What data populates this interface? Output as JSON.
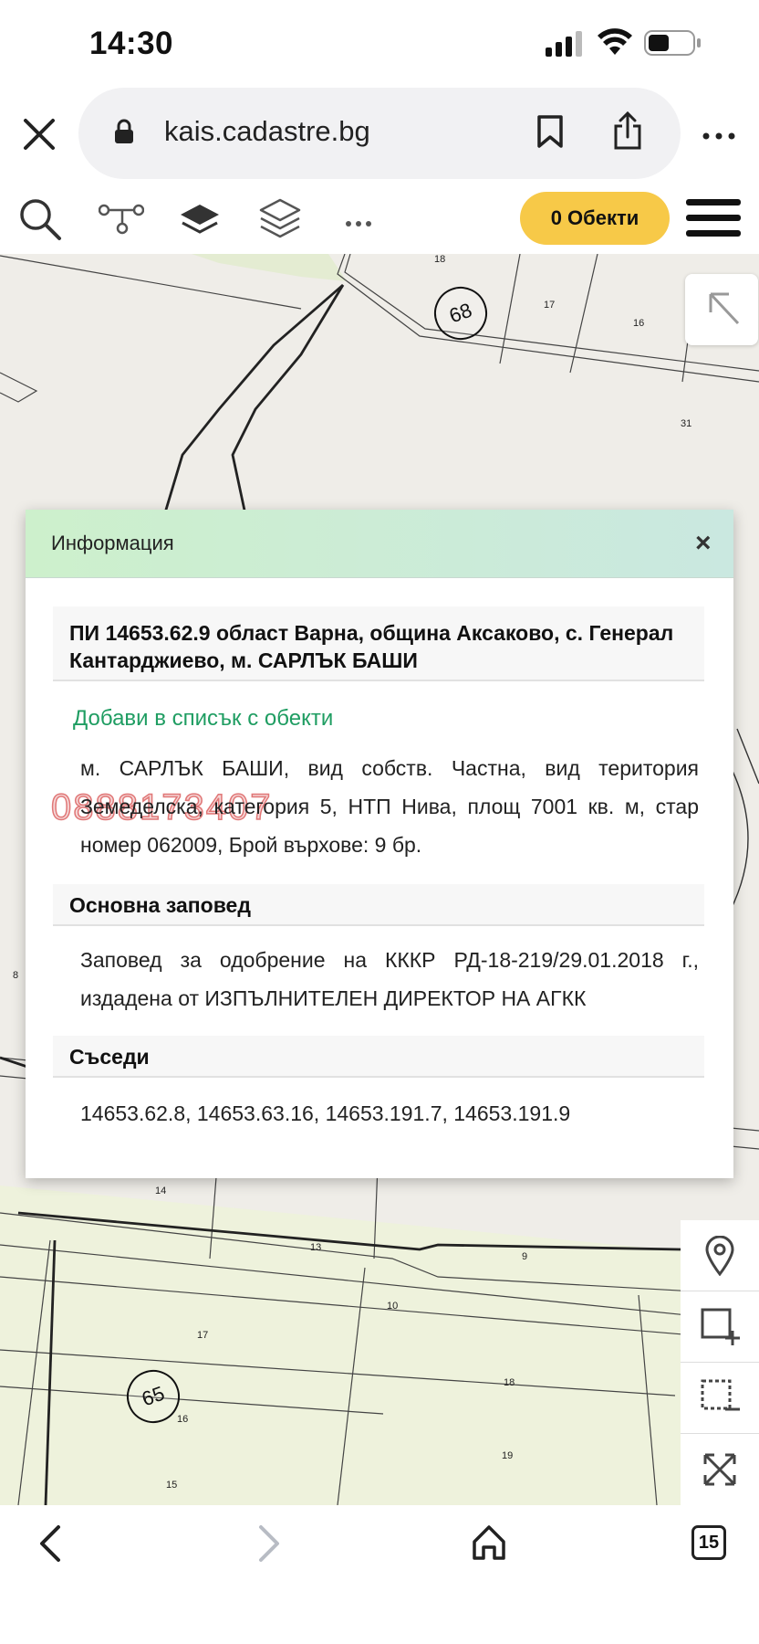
{
  "status_bar": {
    "time": "14:30"
  },
  "browser": {
    "url": "kais.cadastre.bg"
  },
  "toolbar": {
    "objects_button": "0 Обекти"
  },
  "map": {
    "parcel_labels": [
      "68",
      "65"
    ],
    "plot_numbers": [
      "18",
      "17",
      "16",
      "31",
      "14",
      "13",
      "9",
      "17",
      "16",
      "15",
      "18",
      "19",
      "10",
      "8"
    ]
  },
  "info_panel": {
    "title": "Информация",
    "close": "×",
    "heading": "ПИ 14653.62.9 област Варна, община Аксаково, с. Генерал Кантарджиево, м. САРЛЪК БАШИ",
    "add_link": "Добави в списък с обекти",
    "description": "м. САРЛЪК БАШИ, вид собств. Частна, вид територия Земеделска, категория 5, НТП Нива, площ 7001 кв. м, стар номер 062009, Брой върхове: 9 бр.",
    "watermark": "0888173407",
    "order_title": "Основна заповед",
    "order_text": "Заповед за одобрение на КККР РД-18-219/29.01.2018 г., издадена от ИЗПЪЛНИТЕЛЕН ДИРЕКТОР НА АГКК",
    "neighbors_title": "Съседи",
    "neighbors_text": "14653.62.8, 14653.63.16, 14653.191.7, 14653.191.9"
  },
  "bottom_bar": {
    "tabs_count": "15"
  }
}
